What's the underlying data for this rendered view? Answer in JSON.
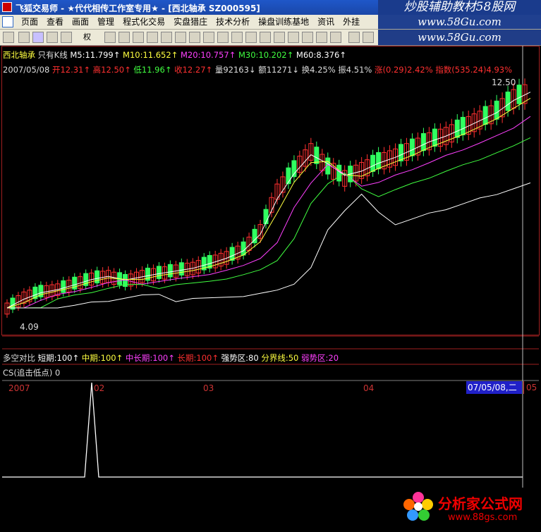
{
  "window": {
    "title": "飞狐交易师 - ★代代相传工作室专用★ - [西北轴承 SZ000595]",
    "watermark_top": "炒股辅助教材58股网",
    "watermark_url": "www.58Gu.com"
  },
  "menu": [
    "页面",
    "查看",
    "画面",
    "管理",
    "程式化交易",
    "实盘猎庄",
    "技术分析",
    "操盘训练基地",
    "资讯",
    "外挂"
  ],
  "toolbar": {
    "rights_label": "权",
    "rsi_label": "RSI"
  },
  "stock_line1": {
    "name": "西北轴承",
    "mode": "只有K线",
    "ma5": "M5:11.799↑",
    "ma10": "M10:11.652↑",
    "ma20": "M20:10.757↑",
    "ma30": "M30:10.202↑",
    "ma60": "M60:8.376↑"
  },
  "stock_line2": {
    "date": "2007/05/08",
    "open": "开12.31↑",
    "high": "高12.50↑",
    "low": "低11.96↑",
    "close": "收12.27↑",
    "volume": "量92163↓",
    "amount": "额11271↓",
    "turnover": "换4.25%",
    "amplitude": "振4.51%",
    "change": "涨(0.29)2.42%",
    "index": "指数(535.24)4.93%"
  },
  "price_labels": {
    "high_mark": "12.50",
    "low_mark": "4.09"
  },
  "x_axis": {
    "labels": [
      "2007",
      "02",
      "03",
      "04"
    ],
    "selected": "07/05/08,二",
    "last": "05"
  },
  "indicator1": {
    "name": "多空对比",
    "short": "短期:100↑",
    "mid": "中期:100↑",
    "midlong": "中长期:100↑",
    "long": "长期:100↑",
    "strong": "强势区:80",
    "boundary": "分界线:50",
    "weak": "弱势区:20"
  },
  "indicator2": {
    "name": "CS(追击低点)",
    "value": "0"
  },
  "footer": {
    "brand": "分析家公式网",
    "url": "www.88gs.com"
  },
  "colors": {
    "up": "#ff3030",
    "down": "#30ff60",
    "ma5": "#ffffff",
    "ma10": "#ffff40",
    "ma20": "#ff40ff",
    "ma30": "#40ff40",
    "ma60": "#ffffff",
    "border": "#a02020"
  },
  "chart_data": {
    "type": "candlestick",
    "close_series_approx": [
      4.09,
      4.5,
      4.7,
      4.8,
      5.0,
      5.2,
      5.3,
      5.1,
      5.3,
      5.4,
      5.5,
      5.6,
      5.8,
      6.0,
      6.3,
      7.0,
      8.5,
      9.3,
      10.0,
      9.4,
      9.0,
      9.3,
      9.6,
      9.8,
      10.1,
      10.4,
      10.6,
      10.9,
      11.2,
      11.5,
      12.0,
      12.27
    ],
    "high": 12.5,
    "low": 4.09
  }
}
